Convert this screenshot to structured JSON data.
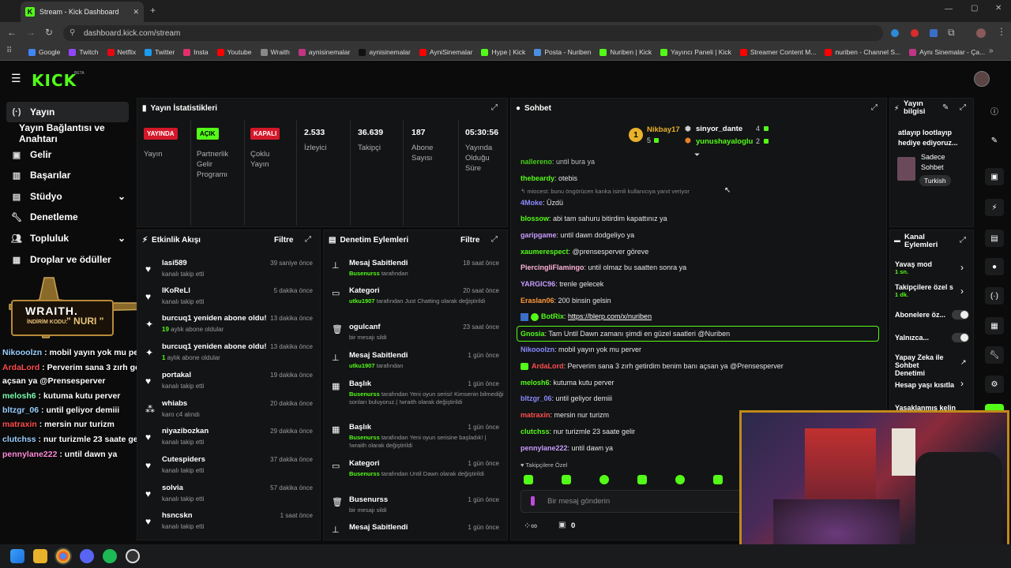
{
  "browser": {
    "tab_title": "Stream - Kick Dashboard",
    "url": "dashboard.kick.com/stream",
    "bookmarks": [
      "Google",
      "Twitch",
      "Netflix",
      "Twitter",
      "Insta",
      "Youtube",
      "Wraith",
      "aynisinemalar",
      "aynisinemalar",
      "AyniSinemalar",
      "Hype | Kick",
      "Posta - Nuriben",
      "Nuriben | Kick",
      "Yayıncı Paneli | Kick",
      "Streamer Content M...",
      "nuriben - Channel S...",
      "Aynı Sinemalar - Ça..."
    ]
  },
  "site": {
    "logo": "KICK",
    "beta": "BETA"
  },
  "sidebar": {
    "items": [
      {
        "label": "Yayın",
        "icon": "broadcast-icon"
      },
      {
        "label": "Yayın Bağlantısı ve Anahtarı",
        "icon": ""
      },
      {
        "label": "Gelir",
        "icon": "money-icon"
      },
      {
        "label": "Başarılar",
        "icon": "trophy-icon"
      },
      {
        "label": "Stüdyo",
        "icon": "studio-icon"
      },
      {
        "label": "Denetleme",
        "icon": "wrench-icon"
      },
      {
        "label": "Topluluk",
        "icon": "people-icon"
      },
      {
        "label": "Droplar ve ödüller",
        "icon": "gift-icon"
      }
    ]
  },
  "overlay": {
    "brand": "WRAITH.",
    "code_label": "İNDİRİM KODU:",
    "code": "\" NURI \"",
    "chat": [
      {
        "user": "Nikooolzn",
        "text": " : mobil yayın yok mu perver",
        "color": "#9ad0ff"
      },
      {
        "user": "ArdaLord",
        "text": " : Perverim sana 3 zırh getirdim benim banı",
        "color": "#ff4d4d"
      },
      {
        "user": "",
        "text": "açsan ya @Prensesperver",
        "color": "#fff"
      },
      {
        "user": "melosh6",
        "text": " : kutuma kutu perver",
        "color": "#7dffb0"
      },
      {
        "user": "bltzgr_06",
        "text": " : until geliyor demiii",
        "color": "#9ad0ff"
      },
      {
        "user": "matraxin",
        "text": " : mersin nur turizm",
        "color": "#ff4d4d"
      },
      {
        "user": "clutchss",
        "text": " : nur turizmle 23 saate gelir",
        "color": "#9ad0ff"
      },
      {
        "user": "pennylane222",
        "text": " : until dawn ya",
        "color": "#ff8ad8"
      }
    ]
  },
  "stats": {
    "title": "Yayın İstatistikleri",
    "live_badge": "YAYINDA",
    "live_label": "Yayın",
    "partner_badge": "AÇIK",
    "partner_label": "Partnerlik Gelir Programı",
    "multi_badge": "KAPALI",
    "multi_label": "Çoklu Yayın",
    "viewers": "2.533",
    "viewers_label": "İzleyici",
    "followers": "36.639",
    "followers_label": "Takipçi",
    "subs": "187",
    "subs_label": "Abone Sayısı",
    "uptime": "05:30:56",
    "uptime_label": "Yayında Olduğu Süre"
  },
  "activity": {
    "title": "Etkinlik Akışı",
    "filter": "Filtre",
    "items": [
      {
        "name": "lasi589",
        "sub": "kanalı takip etti",
        "time": "39 saniye önce",
        "icon": "♥"
      },
      {
        "name": "lKoReLl",
        "sub": "kanalı takip etti",
        "time": "5 dakika önce",
        "icon": "♥"
      },
      {
        "name": "burcuq1 yeniden abone oldu!",
        "sub": "19 aylık abone oldular",
        "time": "13 dakika önce",
        "icon": "✦"
      },
      {
        "name": "burcuq1 yeniden abone oldu!",
        "sub": "1 aylık abone oldular",
        "time": "13 dakika önce",
        "icon": "✦"
      },
      {
        "name": "portakal",
        "sub": "kanalı takip etti",
        "time": "19 dakika önce",
        "icon": "♥"
      },
      {
        "name": "whiabs",
        "sub": "karo c4 alındı",
        "time": "20 dakika önce",
        "icon": "⁂"
      },
      {
        "name": "niyazibozkan",
        "sub": "kanalı takip etti",
        "time": "29 dakika önce",
        "icon": "♥"
      },
      {
        "name": "Cutespiders",
        "sub": "kanalı takip etti",
        "time": "37 dakika önce",
        "icon": "♥"
      },
      {
        "name": "solvia",
        "sub": "kanalı takip etti",
        "time": "57 dakika önce",
        "icon": "♥"
      },
      {
        "name": "hsncskn",
        "sub": "kanalı takip etti",
        "time": "1 saat önce",
        "icon": "♥"
      }
    ]
  },
  "moderation": {
    "title": "Denetim Eylemleri",
    "filter": "Filtre",
    "items": [
      {
        "name": "Mesaj Sabitlendi",
        "who": "Busenurss",
        "rest": " tarafından",
        "time": "18 saat önce",
        "icon": "⊥"
      },
      {
        "name": "Kategori",
        "who": "utku1907",
        "rest": " tarafından Just Chatting olarak değiştirildi",
        "time": "20 saat önce",
        "icon": "▭"
      },
      {
        "name": "ogulcanf",
        "who": "",
        "rest": "bir mesajı sildi",
        "time": "23 saat önce",
        "icon": "🗑"
      },
      {
        "name": "Mesaj Sabitlendi",
        "who": "utku1907",
        "rest": " tarafından",
        "time": "1 gün önce",
        "icon": "⊥"
      },
      {
        "name": "Başlık",
        "who": "Busenurss",
        "rest": " tarafından Yeni oyun serisi! Kimsenin bilmediği sonları buluyoruz.| !wraith olarak değiştirildi",
        "time": "1 gün önce",
        "icon": "▦"
      },
      {
        "name": "Başlık",
        "who": "Busenurss",
        "rest": " tarafından Yeni oyun serisine başladık! | !wraith olarak değiştirildi",
        "time": "1 gün önce",
        "icon": "▦"
      },
      {
        "name": "Kategori",
        "who": "Busenurss",
        "rest": " tarafından Until Dawn olarak değiştirildi",
        "time": "1 gün önce",
        "icon": "▭"
      },
      {
        "name": "Busenurss",
        "who": "",
        "rest": "bir mesajı sildi",
        "time": "1 gün önce",
        "icon": "🗑"
      },
      {
        "name": "Mesaj Sabitlendi",
        "who": "",
        "rest": "",
        "time": "1 gün önce",
        "icon": "⊥"
      }
    ]
  },
  "chat": {
    "title": "Sohbet",
    "top": [
      {
        "rank": "1",
        "name": "Nikbay17",
        "count": "5"
      },
      {
        "name": "sinyor_dante",
        "count": "4"
      },
      {
        "name": "yunushayaloglu",
        "count": "2"
      }
    ],
    "reply_hint": "miocest: bunu öngörücen kanka isimli kullanıcıya yanıt veriyor",
    "messages": [
      {
        "user": "nallereno",
        "color": "#53fc18",
        "text": ": until bura ya"
      },
      {
        "user": "thebeardy",
        "color": "#53fc18",
        "text": ": otebis"
      },
      {
        "user": "4Moke",
        "color": "#8a8aff",
        "text": ": Üzdü"
      },
      {
        "user": "blossow",
        "color": "#53fc18",
        "text": ": abi tam sahuru bitirdim kapattınız ya"
      },
      {
        "user": "garipgame",
        "color": "#c99cff",
        "text": ": until dawn dodgeliyo ya"
      },
      {
        "user": "xaumerespect",
        "color": "#53fc18",
        "text": ": @prensesperver göreve"
      },
      {
        "user": "PiercingliFlamingo",
        "color": "#ffb3d9",
        "text": ": until olmaz bu saatten sonra ya"
      },
      {
        "user": "YARGIC96",
        "color": "#c99cff",
        "text": ": trenle gelecek"
      },
      {
        "user": "Eraslan06",
        "color": "#ff9a3c",
        "text": ": 200 binsin gelsin"
      },
      {
        "user": "BotRix",
        "color": "#53fc18",
        "text": ": ",
        "link": "https://blerp.com/x/nuriben"
      },
      {
        "user": "Gnosia",
        "color": "#53fc18",
        "text": ": Tam Until Dawn zamanı şimdi en güzel saatleri @Nuriben"
      },
      {
        "user": "Nikooolzn",
        "color": "#8a8aff",
        "text": ": mobil yayın yok mu perver"
      },
      {
        "user": "ArdaLord",
        "color": "#ff4d4d",
        "text": ": Perverim sana 3 zırh getirdim benim banı açsan ya @Prensesperver"
      },
      {
        "user": "melosh6",
        "color": "#53fc18",
        "text": ": kutuma kutu perver"
      },
      {
        "user": "bltzgr_06",
        "color": "#8a8aff",
        "text": ": until geliyor demiii"
      },
      {
        "user": "matraxin",
        "color": "#ff4d4d",
        "text": ": mersin nur turizm"
      },
      {
        "user": "clutchss",
        "color": "#53fc18",
        "text": ": nur turizmle 23 saate gelir"
      },
      {
        "user": "pennylane222",
        "color": "#c99cff",
        "text": ": until dawn ya"
      }
    ],
    "followers_only": "Takipçilere Özel",
    "input_placeholder": "Bir mesaj gönderin",
    "points": "0"
  },
  "stream_info": {
    "title": "Yayın bilgisi",
    "desc": "atlayıp lootlayıp hediye ediyoruz...",
    "mode": "Sadece Sohbet",
    "lang": "Turkish"
  },
  "channel_actions": {
    "title": "Kanal Eylemleri",
    "items": [
      {
        "label": "Yavaş mod",
        "sub": "1 sn."
      },
      {
        "label": "Takipçilere özel s",
        "sub": "1 dk."
      },
      {
        "label": "Abonelere öz...",
        "sub": ""
      },
      {
        "label": "Yalnızca...",
        "sub": ""
      },
      {
        "label": "Yapay Zeka ile Sohbet Denetimi",
        "sub": ""
      },
      {
        "label": "Hesap yaşı kısıtla",
        "sub": ""
      },
      {
        "label": "Yasaklanmış kelin",
        "sub": ""
      }
    ]
  }
}
